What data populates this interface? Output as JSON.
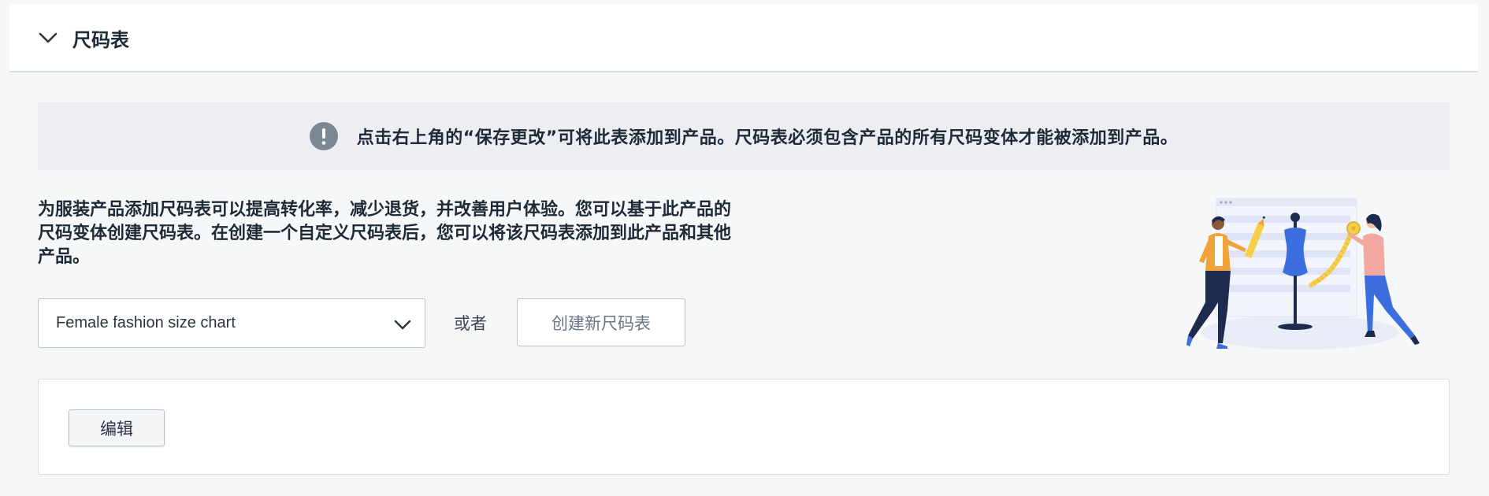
{
  "section": {
    "title": "尺码表"
  },
  "notice": {
    "icon": "exclamation-circle-icon",
    "text": "点击右上角的“保存更改”可将此表添加到产品。尺码表必须包含产品的所有尺码变体才能被添加到产品。"
  },
  "description": {
    "line1": "为服装产品添加尺码表可以提高转化率，减少退货，并改善用户体验。您可以基于此产品的",
    "line2": "尺码变体创建尺码表。在创建一个自定义尺码表后，您可以将该尺码表添加到此产品和其他",
    "line3": "产品。"
  },
  "size_chart_select": {
    "selected": "Female fashion size chart"
  },
  "or_label": "或者",
  "create_button_label": "创建新尺码表",
  "edit_button_label": "编辑",
  "colors": {
    "accent_blue": "#3d6ee0",
    "notice_icon": "#7c8796",
    "figure_orange": "#f0a23b",
    "figure_pink": "#f2a79f",
    "navy": "#1d2b4f",
    "tape_yellow": "#f6cf4a"
  }
}
